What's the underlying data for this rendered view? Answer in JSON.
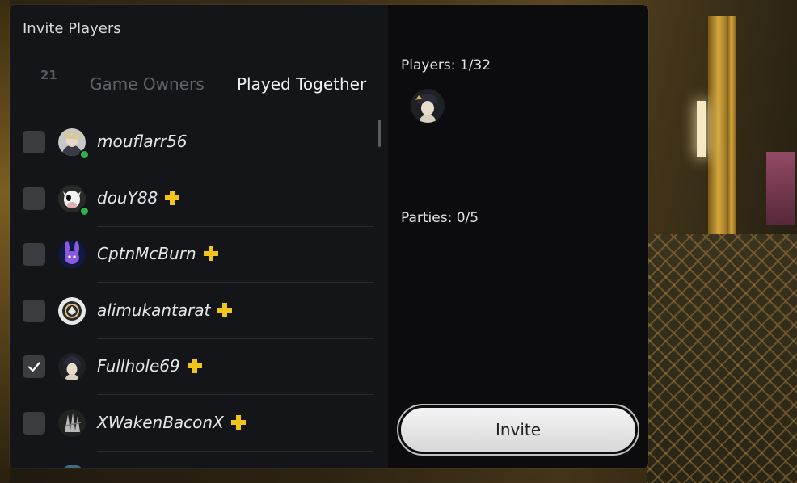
{
  "dialog": {
    "title": "Invite Players",
    "tabs": {
      "count": "21",
      "game_owners": "Game Owners",
      "played_together": "Played Together"
    }
  },
  "players": [
    {
      "name": "mouflarr56",
      "plus": false,
      "online": true,
      "checked": false,
      "avatar_icon": "character-avatar-icon"
    },
    {
      "name": "douY88",
      "plus": true,
      "online": true,
      "checked": false,
      "avatar_icon": "cow-avatar-icon"
    },
    {
      "name": "CptnMcBurn",
      "plus": true,
      "online": false,
      "checked": false,
      "avatar_icon": "purple-bunny-avatar-icon"
    },
    {
      "name": "alimukantarat",
      "plus": true,
      "online": false,
      "checked": false,
      "avatar_icon": "emblem-avatar-icon"
    },
    {
      "name": "Fullhole69",
      "plus": true,
      "online": false,
      "checked": true,
      "avatar_icon": "anime-girl-avatar-icon"
    },
    {
      "name": "XWakenBaconX",
      "plus": true,
      "online": false,
      "checked": false,
      "avatar_icon": "skeleton-avatar-icon"
    }
  ],
  "summary": {
    "players_count": "Players: 1/32",
    "parties_count": "Parties: 0/5"
  },
  "invite_button": "Invite",
  "colors": {
    "plus_yellow": "#f0c419",
    "online_green": "#2fb24a",
    "dialog_bg": "#0f1012"
  }
}
